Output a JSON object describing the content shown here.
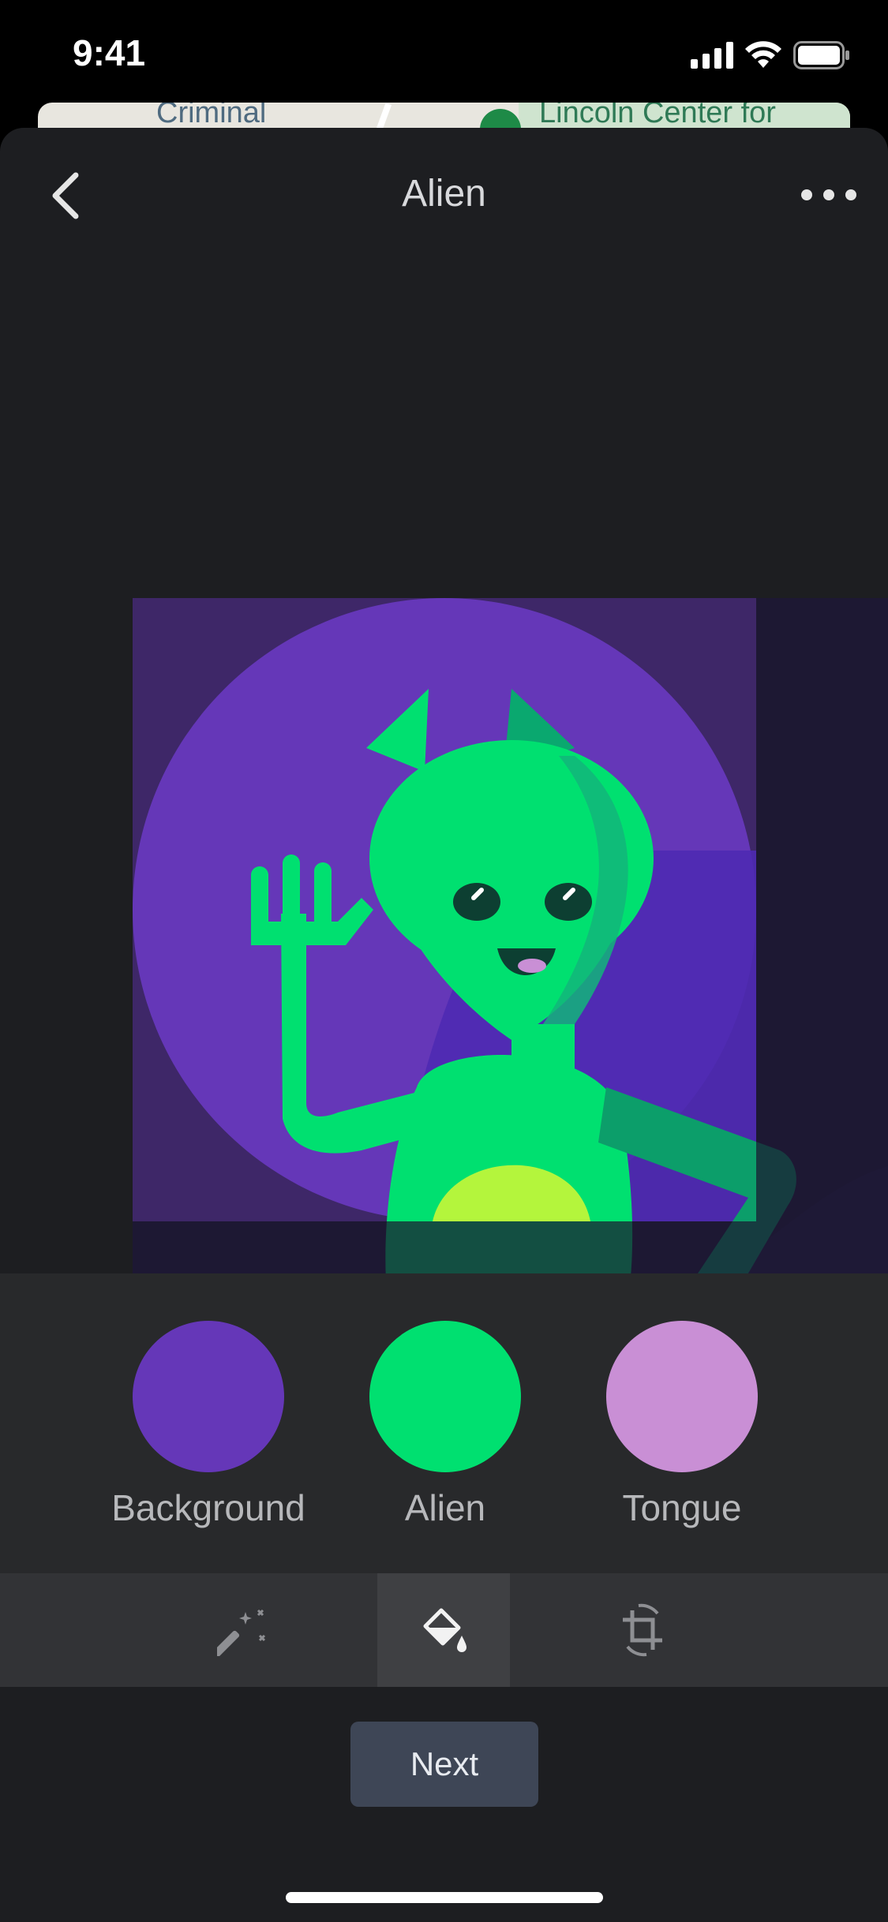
{
  "status_bar": {
    "time": "9:41"
  },
  "map": {
    "left_label": "Criminal",
    "right_label": "Lincoln Center for"
  },
  "header": {
    "title": "Alien"
  },
  "swatches": [
    {
      "label": "Background",
      "color": "#6537b8"
    },
    {
      "label": "Alien",
      "color": "#00e070"
    },
    {
      "label": "Tongue",
      "color": "#c98fd5"
    }
  ],
  "toolbar": {
    "tools": [
      {
        "icon": "magic-wand-icon",
        "active": false
      },
      {
        "icon": "paint-bucket-icon",
        "active": true
      },
      {
        "icon": "crop-rotate-icon",
        "active": false
      }
    ]
  },
  "footer": {
    "next_label": "Next"
  },
  "colors": {
    "sheet": "#1d1e21",
    "panel": "#28292b",
    "toolbar": "#323336",
    "button": "#3e4656",
    "alien_green": "#00e070",
    "belly": "#b4f53c",
    "purple": "#6537b8"
  }
}
